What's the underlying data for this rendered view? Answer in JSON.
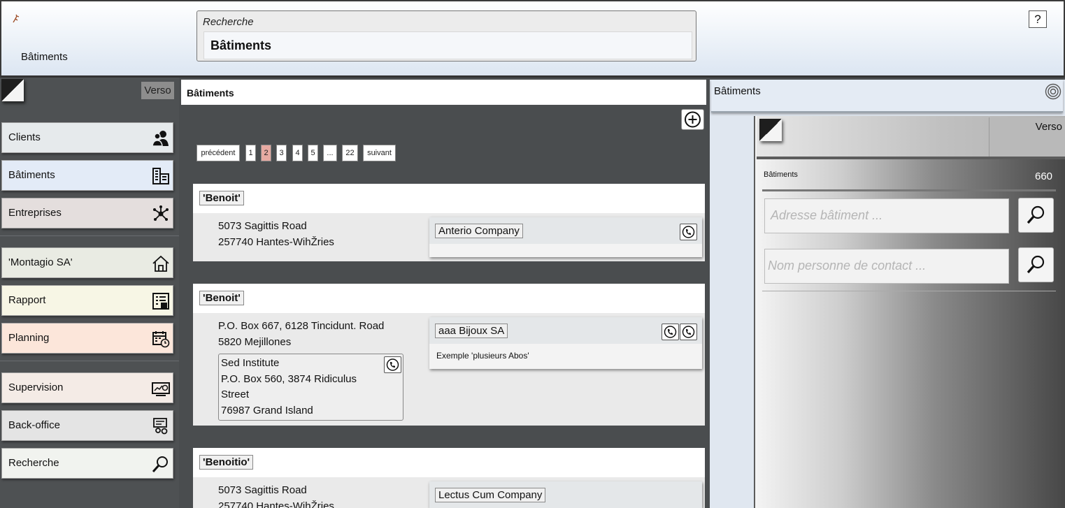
{
  "header": {
    "section_label": "Bâtiments",
    "search_legend": "Recherche",
    "search_value": "Bâtiments",
    "help_label": "?"
  },
  "sidebar": {
    "verso_label": "Verso",
    "items": [
      {
        "label": "Clients",
        "icon": "clients-icon",
        "bg": "#e6eaec"
      },
      {
        "label": "Bâtiments",
        "icon": "building-icon",
        "bg": "#e3ebf7"
      },
      {
        "label": "Entreprises",
        "icon": "network-icon",
        "bg": "#e4dedd"
      },
      {
        "label": "'Montagio SA'",
        "icon": "home-icon",
        "bg": "#e9ebe3"
      },
      {
        "label": "Rapport",
        "icon": "report-icon",
        "bg": "#f7f6e5"
      },
      {
        "label": "Planning",
        "icon": "calendar-icon",
        "bg": "#fce6da"
      },
      {
        "label": "Supervision",
        "icon": "monitor-icon",
        "bg": "#f4ebe6"
      },
      {
        "label": "Back-office",
        "icon": "backoffice-icon",
        "bg": "#e4e4e4"
      },
      {
        "label": "Recherche",
        "icon": "search-icon",
        "bg": "#f1f3ef"
      }
    ]
  },
  "center": {
    "title": "Bâtiments",
    "pager": {
      "prev": "précédent",
      "pages": [
        "1",
        "2",
        "3",
        "4",
        "5",
        "...",
        "22"
      ],
      "active": "2",
      "next": "suivant"
    },
    "cards": [
      {
        "name": "'Benoit'",
        "address": [
          "5073 Sagittis Road",
          "257740 Hantes-WihŽries"
        ],
        "company": "Anterio Company",
        "note": ""
      },
      {
        "name": "'Benoit'",
        "address": [
          "P.O. Box 667, 6128 Tincidunt. Road",
          "5820 Mejillones"
        ],
        "company": "aaa Bijoux SA",
        "note": "Exemple 'plusieurs Abos'",
        "sub": [
          "Sed Institute",
          "P.O. Box 560, 3874 Ridiculus",
          "Street",
          "76987 Grand Island"
        ]
      },
      {
        "name": "'Benoitio'",
        "address": [
          "5073 Sagittis Road",
          "257740 Hantes-WihŽries"
        ],
        "company": "Lectus Cum Company",
        "note": ""
      }
    ]
  },
  "right": {
    "title": "Bâtiments",
    "verso_label": "Verso",
    "count_label": "Bâtiments",
    "count_value": "660",
    "address_placeholder": "Adresse bâtiment ...",
    "contact_placeholder": "Nom personne de contact ..."
  }
}
